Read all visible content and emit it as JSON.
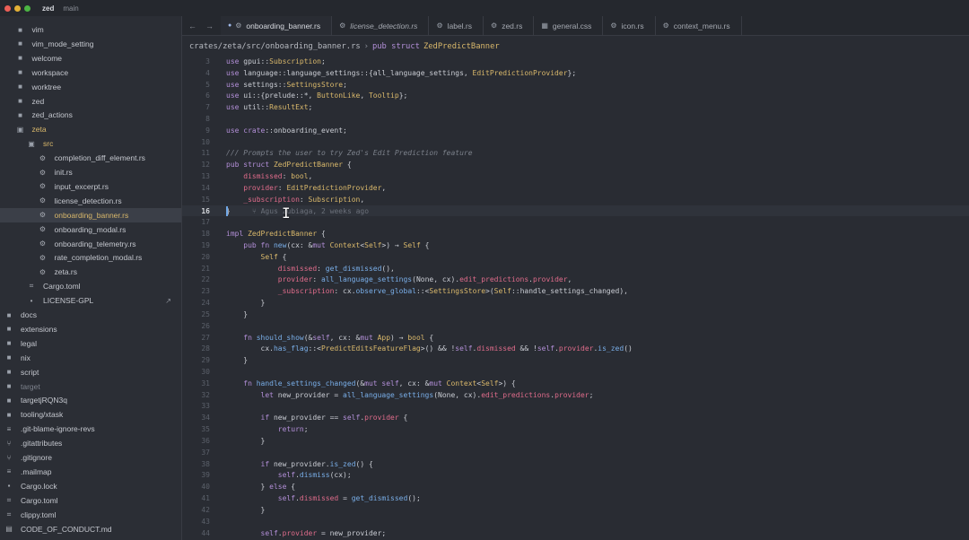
{
  "titlebar": {
    "app": "zed",
    "branch": "main",
    "traffic": [
      "#ec5f57",
      "#e2b036",
      "#4cb543"
    ]
  },
  "sidebar": {
    "items": [
      {
        "label": "vim",
        "icon": "folder-icon",
        "indent": 2
      },
      {
        "label": "vim_mode_setting",
        "icon": "folder-icon",
        "indent": 2
      },
      {
        "label": "welcome",
        "icon": "folder-icon",
        "indent": 2
      },
      {
        "label": "workspace",
        "icon": "folder-icon",
        "indent": 2
      },
      {
        "label": "worktree",
        "icon": "folder-icon",
        "indent": 2
      },
      {
        "label": "zed",
        "icon": "folder-icon",
        "indent": 2
      },
      {
        "label": "zed_actions",
        "icon": "folder-icon",
        "indent": 2
      },
      {
        "label": "zeta",
        "icon": "folder-open-icon",
        "indent": 2,
        "hl": true
      },
      {
        "label": "src",
        "icon": "folder-open-icon",
        "indent": 3,
        "hl": true
      },
      {
        "label": "completion_diff_element.rs",
        "icon": "rust-file-icon",
        "indent": 4
      },
      {
        "label": "init.rs",
        "icon": "rust-file-icon",
        "indent": 4
      },
      {
        "label": "input_excerpt.rs",
        "icon": "rust-file-icon",
        "indent": 4
      },
      {
        "label": "license_detection.rs",
        "icon": "rust-file-icon",
        "indent": 4
      },
      {
        "label": "onboarding_banner.rs",
        "icon": "rust-file-icon",
        "indent": 4,
        "active": true,
        "hl": true
      },
      {
        "label": "onboarding_modal.rs",
        "icon": "rust-file-icon",
        "indent": 4
      },
      {
        "label": "onboarding_telemetry.rs",
        "icon": "rust-file-icon",
        "indent": 4
      },
      {
        "label": "rate_completion_modal.rs",
        "icon": "rust-file-icon",
        "indent": 4
      },
      {
        "label": "zeta.rs",
        "icon": "rust-file-icon",
        "indent": 4
      },
      {
        "label": "Cargo.toml",
        "icon": "toml-file-icon",
        "indent": 3
      },
      {
        "label": "LICENSE-GPL",
        "icon": "license-file-icon",
        "indent": 3,
        "external": true
      },
      {
        "label": "docs",
        "icon": "folder-icon",
        "indent": 1
      },
      {
        "label": "extensions",
        "icon": "folder-icon",
        "indent": 1
      },
      {
        "label": "legal",
        "icon": "folder-icon",
        "indent": 1
      },
      {
        "label": "nix",
        "icon": "folder-icon",
        "indent": 1
      },
      {
        "label": "script",
        "icon": "folder-icon",
        "indent": 1
      },
      {
        "label": "target",
        "icon": "folder-icon",
        "indent": 1,
        "dim": true
      },
      {
        "label": "targetjRQN3q",
        "icon": "folder-icon",
        "indent": 1
      },
      {
        "label": "tooling/xtask",
        "icon": "folder-icon",
        "indent": 1
      },
      {
        "label": ".git-blame-ignore-revs",
        "icon": "text-file-icon",
        "indent": 1
      },
      {
        "label": ".gitattributes",
        "icon": "git-file-icon",
        "indent": 1
      },
      {
        "label": ".gitignore",
        "icon": "git-file-icon",
        "indent": 1
      },
      {
        "label": ".mailmap",
        "icon": "text-file-icon",
        "indent": 1
      },
      {
        "label": "Cargo.lock",
        "icon": "lock-file-icon",
        "indent": 1
      },
      {
        "label": "Cargo.toml",
        "icon": "toml-file-icon",
        "indent": 1
      },
      {
        "label": "clippy.toml",
        "icon": "toml-file-icon",
        "indent": 1
      },
      {
        "label": "CODE_OF_CONDUCT.md",
        "icon": "markdown-file-icon",
        "indent": 1
      }
    ]
  },
  "tabs": [
    {
      "label": "onboarding_banner.rs",
      "icon": "rust-file-icon",
      "active": true,
      "modified": true
    },
    {
      "label": "license_detection.rs",
      "icon": "rust-file-icon",
      "italic": true
    },
    {
      "label": "label.rs",
      "icon": "rust-file-icon"
    },
    {
      "label": "zed.rs",
      "icon": "rust-file-icon"
    },
    {
      "label": "general.css",
      "icon": "css-file-icon"
    },
    {
      "label": "icon.rs",
      "icon": "rust-file-icon"
    },
    {
      "label": "context_menu.rs",
      "icon": "rust-file-icon"
    }
  ],
  "breadcrumb": {
    "path": "crates/zeta/src/onboarding_banner.rs",
    "separator": "›",
    "keyword": "pub struct",
    "symbol": "ZedPredictBanner"
  },
  "editor": {
    "current_line": 16,
    "blame": "Agus Zubiaga, 2 weeks ago",
    "lines": [
      {
        "n": "3",
        "tokens": [
          [
            "k",
            "use "
          ],
          [
            "p",
            "gpui::"
          ],
          [
            "t",
            "Subscription"
          ],
          [
            "p",
            ";"
          ]
        ]
      },
      {
        "n": "4",
        "tokens": [
          [
            "k",
            "use "
          ],
          [
            "p",
            "language::language_settings::{all_language_settings, "
          ],
          [
            "t",
            "EditPredictionProvider"
          ],
          [
            "p",
            "};"
          ]
        ]
      },
      {
        "n": "5",
        "tokens": [
          [
            "k",
            "use "
          ],
          [
            "p",
            "settings::"
          ],
          [
            "t",
            "SettingsStore"
          ],
          [
            "p",
            ";"
          ]
        ]
      },
      {
        "n": "6",
        "tokens": [
          [
            "k",
            "use "
          ],
          [
            "p",
            "ui::{prelude::*, "
          ],
          [
            "t",
            "ButtonLike"
          ],
          [
            "p",
            ", "
          ],
          [
            "t",
            "Tooltip"
          ],
          [
            "p",
            "};"
          ]
        ]
      },
      {
        "n": "7",
        "tokens": [
          [
            "k",
            "use "
          ],
          [
            "p",
            "util::"
          ],
          [
            "t",
            "ResultExt"
          ],
          [
            "p",
            ";"
          ]
        ]
      },
      {
        "n": "8",
        "tokens": []
      },
      {
        "n": "9",
        "tokens": [
          [
            "k",
            "use "
          ],
          [
            "k",
            "crate"
          ],
          [
            "p",
            "::onboarding_event;"
          ]
        ]
      },
      {
        "n": "10",
        "tokens": []
      },
      {
        "n": "11",
        "tokens": [
          [
            "c",
            "/// Prompts the user to try Zed's Edit Prediction feature"
          ]
        ]
      },
      {
        "n": "12",
        "tokens": [
          [
            "k",
            "pub struct "
          ],
          [
            "t",
            "ZedPredictBanner"
          ],
          [
            "p",
            " {"
          ]
        ]
      },
      {
        "n": "13",
        "tokens": [
          [
            "p",
            "    "
          ],
          [
            "fl",
            "dismissed"
          ],
          [
            "p",
            ": "
          ],
          [
            "t",
            "bool"
          ],
          [
            "p",
            ","
          ]
        ]
      },
      {
        "n": "14",
        "tokens": [
          [
            "p",
            "    "
          ],
          [
            "fl",
            "provider"
          ],
          [
            "p",
            ": "
          ],
          [
            "t",
            "EditPredictionProvider"
          ],
          [
            "p",
            ","
          ]
        ]
      },
      {
        "n": "15",
        "tokens": [
          [
            "p",
            "    "
          ],
          [
            "fl",
            "_subscription"
          ],
          [
            "p",
            ": "
          ],
          [
            "t",
            "Subscription"
          ],
          [
            "p",
            ","
          ]
        ]
      },
      {
        "n": "16",
        "tokens": [
          [
            "p",
            "}"
          ]
        ],
        "blame": true
      },
      {
        "n": "17",
        "tokens": []
      },
      {
        "n": "18",
        "tokens": [
          [
            "k",
            "impl "
          ],
          [
            "t",
            "ZedPredictBanner"
          ],
          [
            "p",
            " {"
          ]
        ]
      },
      {
        "n": "19",
        "tokens": [
          [
            "p",
            "    "
          ],
          [
            "k",
            "pub fn "
          ],
          [
            "f",
            "new"
          ],
          [
            "p",
            "(cx: &"
          ],
          [
            "k",
            "mut "
          ],
          [
            "t",
            "Context"
          ],
          [
            "p",
            "<"
          ],
          [
            "t",
            "Self"
          ],
          [
            "p",
            ">) → "
          ],
          [
            "t",
            "Self"
          ],
          [
            "p",
            " {"
          ]
        ]
      },
      {
        "n": "20",
        "tokens": [
          [
            "p",
            "        "
          ],
          [
            "t",
            "Self"
          ],
          [
            "p",
            " {"
          ]
        ]
      },
      {
        "n": "21",
        "tokens": [
          [
            "p",
            "            "
          ],
          [
            "fl",
            "dismissed"
          ],
          [
            "p",
            ": "
          ],
          [
            "f",
            "get_dismissed"
          ],
          [
            "p",
            "(),"
          ]
        ]
      },
      {
        "n": "22",
        "tokens": [
          [
            "p",
            "            "
          ],
          [
            "fl",
            "provider"
          ],
          [
            "p",
            ": "
          ],
          [
            "f",
            "all_language_settings"
          ],
          [
            "p",
            "(None, cx)."
          ],
          [
            "fl",
            "edit_predictions"
          ],
          [
            "p",
            "."
          ],
          [
            "fl",
            "provider"
          ],
          [
            "p",
            ","
          ]
        ]
      },
      {
        "n": "23",
        "tokens": [
          [
            "p",
            "            "
          ],
          [
            "fl",
            "_subscription"
          ],
          [
            "p",
            ": cx."
          ],
          [
            "f",
            "observe_global"
          ],
          [
            "p",
            "::<"
          ],
          [
            "t",
            "SettingsStore"
          ],
          [
            "p",
            ">("
          ],
          [
            "t",
            "Self"
          ],
          [
            "p",
            "::handle_settings_changed),"
          ]
        ]
      },
      {
        "n": "24",
        "tokens": [
          [
            "p",
            "        }"
          ]
        ]
      },
      {
        "n": "25",
        "tokens": [
          [
            "p",
            "    }"
          ]
        ]
      },
      {
        "n": "26",
        "tokens": []
      },
      {
        "n": "27",
        "tokens": [
          [
            "p",
            "    "
          ],
          [
            "k",
            "fn "
          ],
          [
            "f",
            "should_show"
          ],
          [
            "p",
            "(&"
          ],
          [
            "k",
            "self"
          ],
          [
            "p",
            ", cx: &"
          ],
          [
            "k",
            "mut "
          ],
          [
            "t",
            "App"
          ],
          [
            "p",
            ") → "
          ],
          [
            "t",
            "bool"
          ],
          [
            "p",
            " {"
          ]
        ]
      },
      {
        "n": "28",
        "tokens": [
          [
            "p",
            "        cx."
          ],
          [
            "f",
            "has_flag"
          ],
          [
            "p",
            "::<"
          ],
          [
            "t",
            "PredictEditsFeatureFlag"
          ],
          [
            "p",
            ">() && !"
          ],
          [
            "k",
            "self"
          ],
          [
            "p",
            "."
          ],
          [
            "fl",
            "dismissed"
          ],
          [
            "p",
            " && !"
          ],
          [
            "k",
            "self"
          ],
          [
            "p",
            "."
          ],
          [
            "fl",
            "provider"
          ],
          [
            "p",
            "."
          ],
          [
            "f",
            "is_zed"
          ],
          [
            "p",
            "()"
          ]
        ]
      },
      {
        "n": "29",
        "tokens": [
          [
            "p",
            "    }"
          ]
        ]
      },
      {
        "n": "30",
        "tokens": []
      },
      {
        "n": "31",
        "tokens": [
          [
            "p",
            "    "
          ],
          [
            "k",
            "fn "
          ],
          [
            "f",
            "handle_settings_changed"
          ],
          [
            "p",
            "(&"
          ],
          [
            "k",
            "mut self"
          ],
          [
            "p",
            ", cx: &"
          ],
          [
            "k",
            "mut "
          ],
          [
            "t",
            "Context"
          ],
          [
            "p",
            "<"
          ],
          [
            "t",
            "Self"
          ],
          [
            "p",
            ">) {"
          ]
        ]
      },
      {
        "n": "32",
        "tokens": [
          [
            "p",
            "        "
          ],
          [
            "k",
            "let "
          ],
          [
            "p",
            "new_provider = "
          ],
          [
            "f",
            "all_language_settings"
          ],
          [
            "p",
            "(None, cx)."
          ],
          [
            "fl",
            "edit_predictions"
          ],
          [
            "p",
            "."
          ],
          [
            "fl",
            "provider"
          ],
          [
            "p",
            ";"
          ]
        ]
      },
      {
        "n": "33",
        "tokens": []
      },
      {
        "n": "34",
        "tokens": [
          [
            "p",
            "        "
          ],
          [
            "k",
            "if "
          ],
          [
            "p",
            "new_provider == "
          ],
          [
            "k",
            "self"
          ],
          [
            "p",
            "."
          ],
          [
            "fl",
            "provider"
          ],
          [
            "p",
            " {"
          ]
        ]
      },
      {
        "n": "35",
        "tokens": [
          [
            "p",
            "            "
          ],
          [
            "k",
            "return"
          ],
          [
            "p",
            ";"
          ]
        ]
      },
      {
        "n": "36",
        "tokens": [
          [
            "p",
            "        }"
          ]
        ]
      },
      {
        "n": "37",
        "tokens": []
      },
      {
        "n": "38",
        "tokens": [
          [
            "p",
            "        "
          ],
          [
            "k",
            "if "
          ],
          [
            "p",
            "new_provider."
          ],
          [
            "f",
            "is_zed"
          ],
          [
            "p",
            "() {"
          ]
        ]
      },
      {
        "n": "39",
        "tokens": [
          [
            "p",
            "            "
          ],
          [
            "k",
            "self"
          ],
          [
            "p",
            "."
          ],
          [
            "f",
            "dismiss"
          ],
          [
            "p",
            "(cx);"
          ]
        ]
      },
      {
        "n": "40",
        "tokens": [
          [
            "p",
            "        } "
          ],
          [
            "k",
            "else"
          ],
          [
            "p",
            " {"
          ]
        ]
      },
      {
        "n": "41",
        "tokens": [
          [
            "p",
            "            "
          ],
          [
            "k",
            "self"
          ],
          [
            "p",
            "."
          ],
          [
            "fl",
            "dismissed"
          ],
          [
            "p",
            " = "
          ],
          [
            "f",
            "get_dismissed"
          ],
          [
            "p",
            "();"
          ]
        ]
      },
      {
        "n": "42",
        "tokens": [
          [
            "p",
            "        }"
          ]
        ]
      },
      {
        "n": "43",
        "tokens": []
      },
      {
        "n": "44",
        "tokens": [
          [
            "p",
            "        "
          ],
          [
            "k",
            "self"
          ],
          [
            "p",
            "."
          ],
          [
            "fl",
            "provider"
          ],
          [
            "p",
            " = new_provider;"
          ]
        ]
      }
    ]
  }
}
